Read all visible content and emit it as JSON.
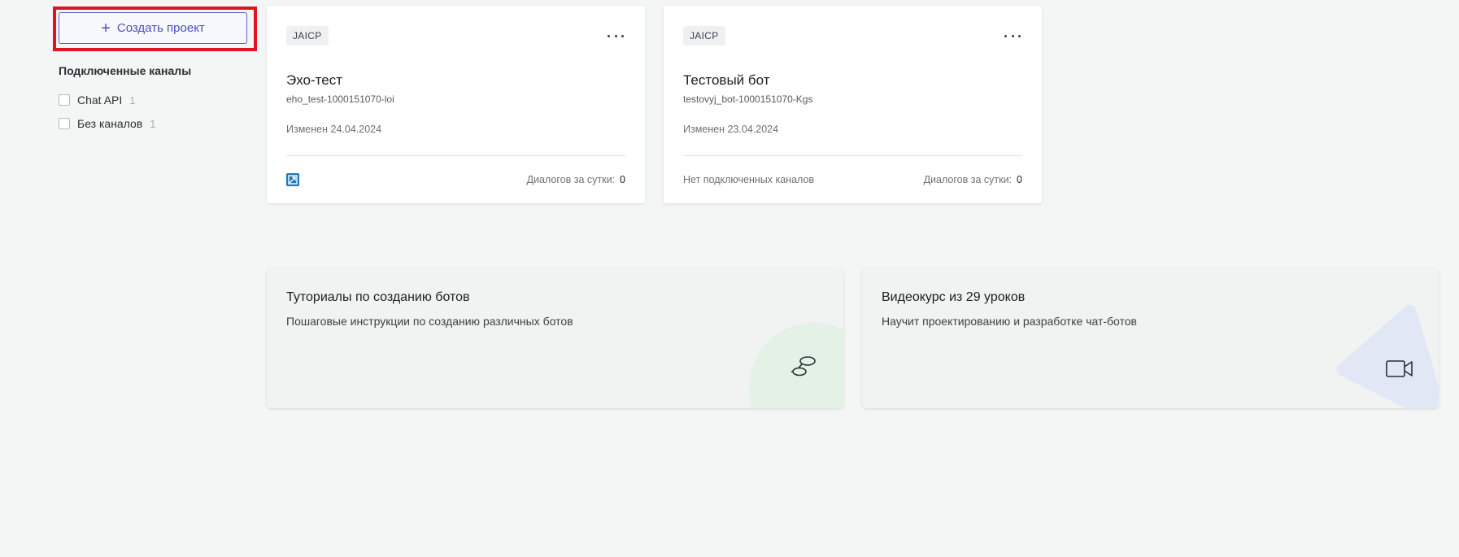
{
  "sidebar": {
    "create_button": {
      "icon": "plus-icon",
      "label": "Создать проект"
    },
    "channels_title": "Подключенные каналы",
    "channels": [
      {
        "label": "Chat API",
        "count": "1",
        "checked": false
      },
      {
        "label": "Без каналов",
        "count": "1",
        "checked": false
      }
    ]
  },
  "projects": [
    {
      "tag": "JAICP",
      "name": "Эхо-тест",
      "slug": "eho_test-1000151070-loi",
      "modified": "Изменен 24.04.2024",
      "channel_icon": "chat-api-icon",
      "dialogs_label": "Диалогов за сутки:",
      "dialogs_count": "0"
    },
    {
      "tag": "JAICP",
      "name": "Тестовый бот",
      "slug": "testovyj_bot-1000151070-Kgs",
      "modified": "Изменен 23.04.2024",
      "no_channels": "Нет подключенных каналов",
      "dialogs_label": "Диалогов за сутки:",
      "dialogs_count": "0"
    }
  ],
  "promos": [
    {
      "title": "Туториалы по созданию ботов",
      "description": "Пошаговые инструкции по созданию различных ботов",
      "icon": "footsteps-icon",
      "accent": "#e3f1e6"
    },
    {
      "title": "Видеокурс из 29 уроков",
      "description": "Научит проектированию и разработке чат-ботов",
      "icon": "video-camera-icon",
      "accent": "#e1e7f4"
    }
  ],
  "colors": {
    "highlight": "#e0141e",
    "primary": "#5b5fc7",
    "background": "#f4f5f5"
  }
}
